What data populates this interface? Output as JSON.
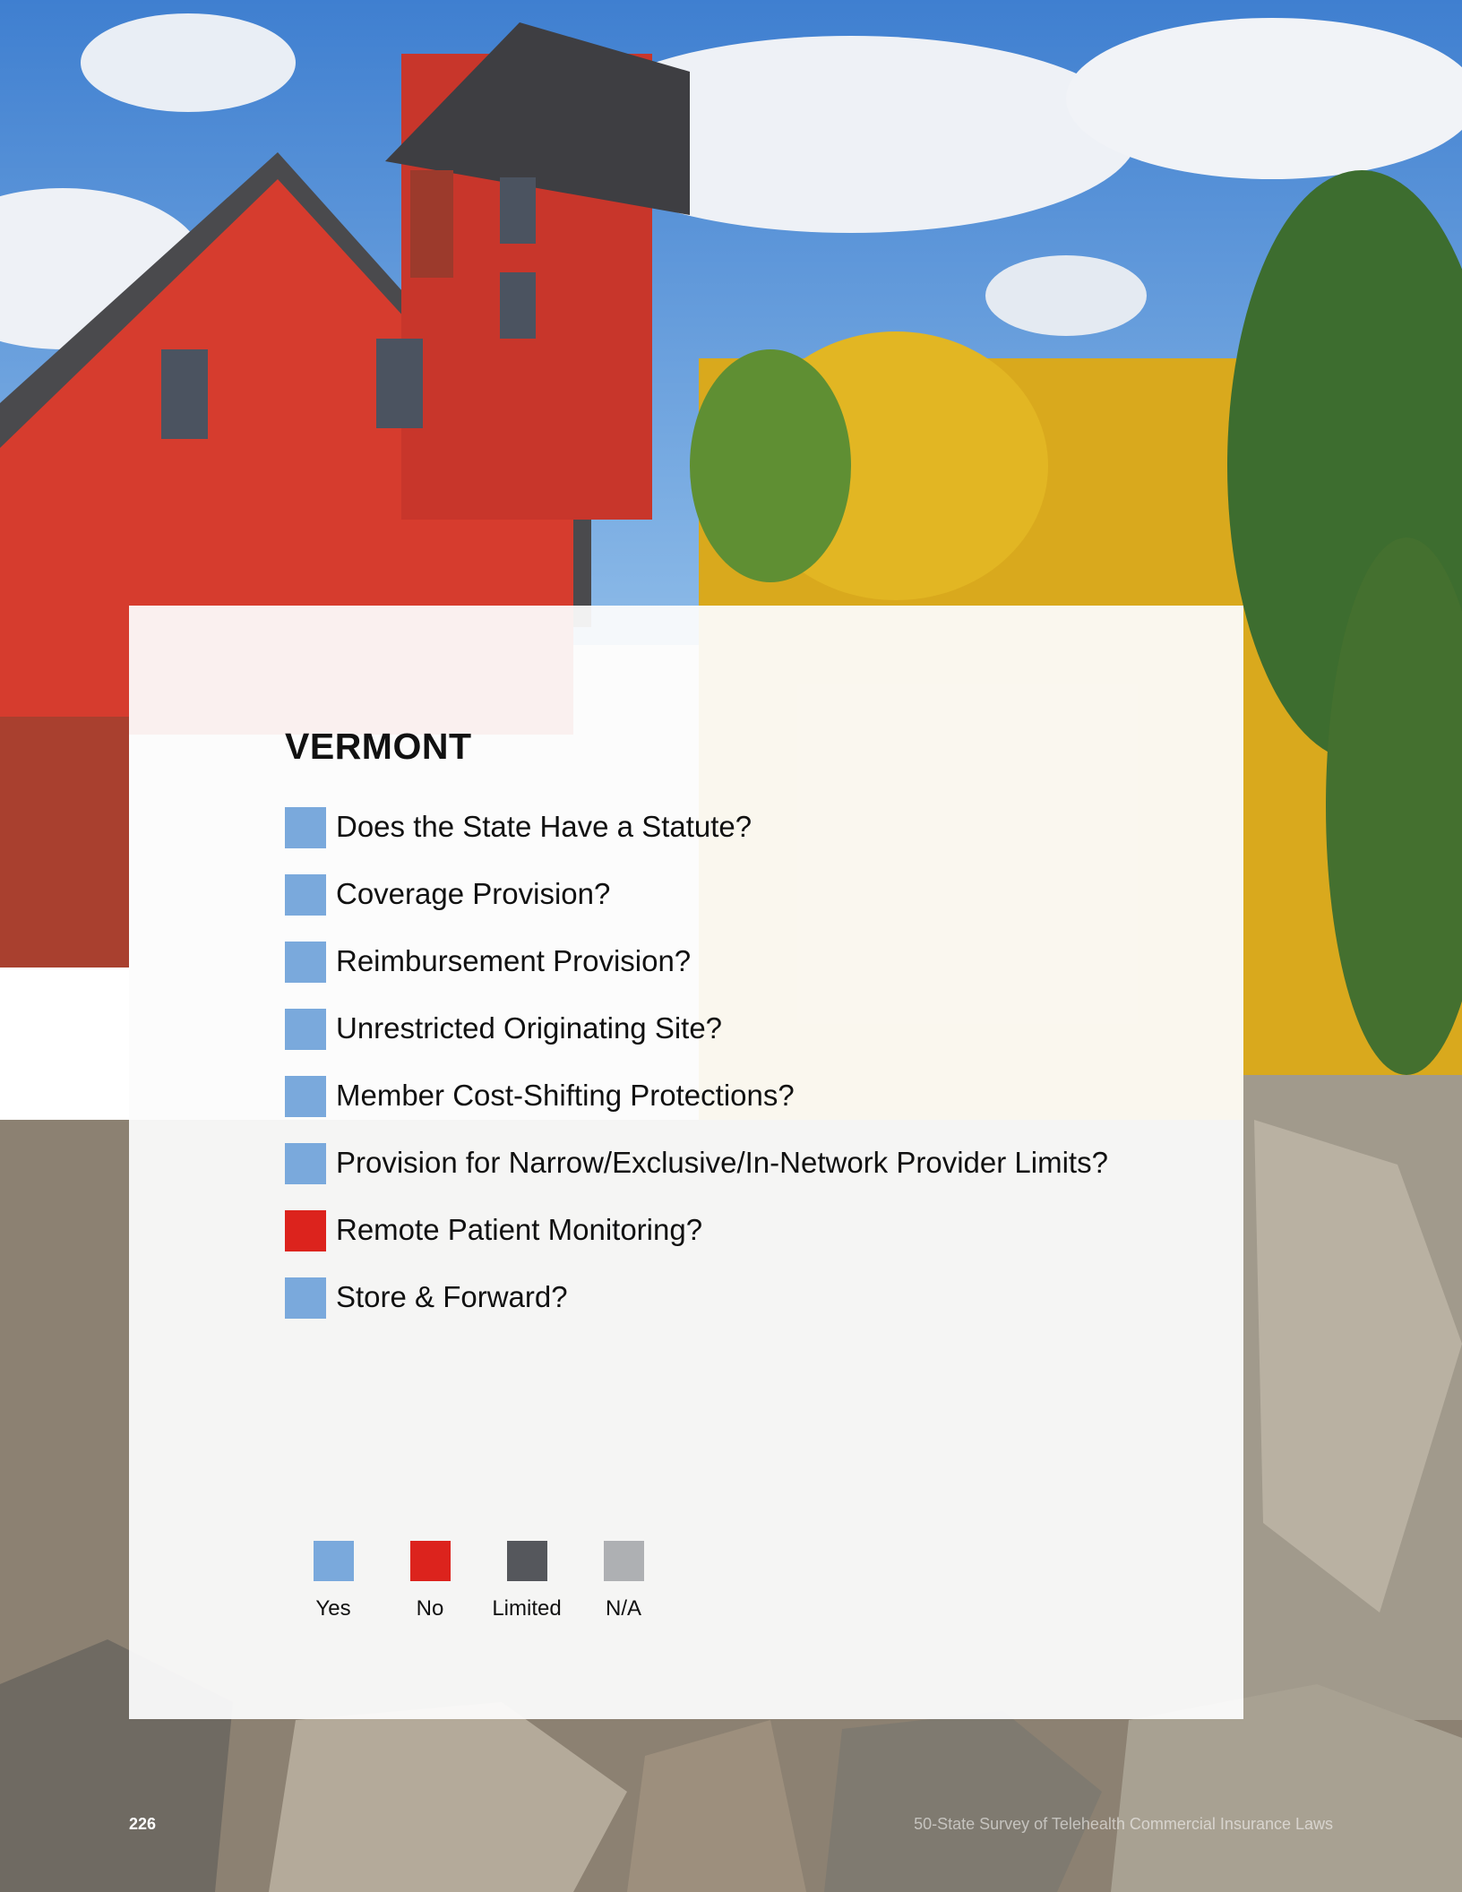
{
  "page": {
    "state": "VERMONT",
    "page_number": "226",
    "footer_title": "50-State Survey of Telehealth Commercial Insurance Laws"
  },
  "colors": {
    "yes": "#7aa9dc",
    "no": "#dc231d",
    "limited": "#55575c",
    "na": "#aeb0b3"
  },
  "items": [
    {
      "label": "Does the State Have a Statute?",
      "status": "yes"
    },
    {
      "label": "Coverage Provision?",
      "status": "yes"
    },
    {
      "label": "Reimbursement Provision?",
      "status": "yes"
    },
    {
      "label": "Unrestricted Originating Site?",
      "status": "yes"
    },
    {
      "label": "Member Cost-Shifting Protections?",
      "status": "yes"
    },
    {
      "label": "Provision for Narrow/Exclusive/In-Network Provider Limits?",
      "status": "yes"
    },
    {
      "label": "Remote Patient Monitoring?",
      "status": "no"
    },
    {
      "label": "Store & Forward?",
      "status": "yes"
    }
  ],
  "legend": [
    {
      "label": "Yes",
      "status": "yes"
    },
    {
      "label": "No",
      "status": "no"
    },
    {
      "label": "Limited",
      "status": "limited"
    },
    {
      "label": "N/A",
      "status": "na"
    }
  ]
}
